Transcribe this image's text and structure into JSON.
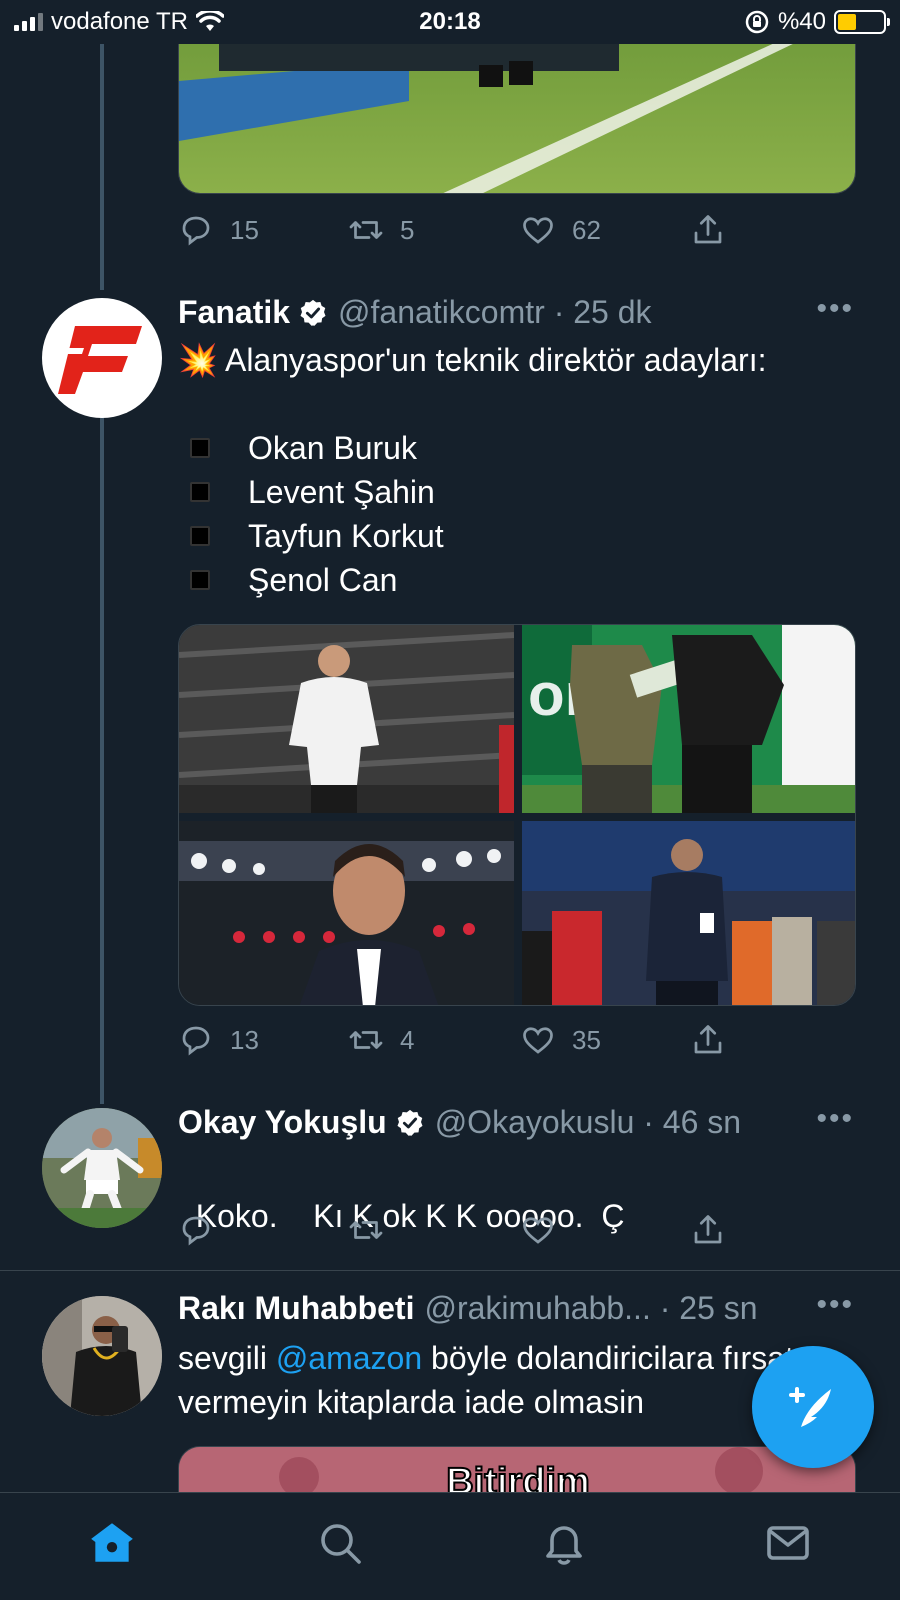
{
  "status_bar": {
    "carrier": "vodafone TR",
    "time": "20:18",
    "battery_text": "%40",
    "battery_level": 0.4
  },
  "colors": {
    "background": "#15202b",
    "accent": "#1da1f2",
    "muted": "#8899a6",
    "fanatik_red": "#e2231a"
  },
  "tweets": [
    {
      "replies": "15",
      "retweets": "5",
      "likes": "62"
    },
    {
      "name": "Fanatik",
      "verified": true,
      "handle": "@fanatikcomtr · 25 dk",
      "intro": "💥 Alanyaspor'un teknik direktör adayları:",
      "list": [
        "Okan Buruk",
        "Levent Şahin",
        "Tayfun Korkut",
        "Şenol Can"
      ],
      "replies": "13",
      "retweets": "4",
      "likes": "35"
    },
    {
      "name": "Okay Yokuşlu",
      "verified": true,
      "handle": "@Okayokuslu · 46 sn",
      "text": "Koko.    Kı K ok K K ooooo.  Ç"
    },
    {
      "name": "Rakı Muhabbeti",
      "handle": "@rakimuhabb... · 25 sn",
      "text_before": "sevgili ",
      "mention": "@amazon",
      "text_after": " böyle dolandiricilara fırsat",
      "text_line2": "vermeyin kitaplarda iade olmasin",
      "image_caption": "Bitirdim"
    }
  ],
  "icons": {
    "reply": "reply-icon",
    "retweet": "retweet-icon",
    "like": "heart-icon",
    "share": "share-icon",
    "more": "more-icon",
    "compose": "compose-tweet-icon"
  },
  "bottom_nav": [
    "home-icon",
    "search-icon",
    "notifications-icon",
    "messages-icon"
  ]
}
